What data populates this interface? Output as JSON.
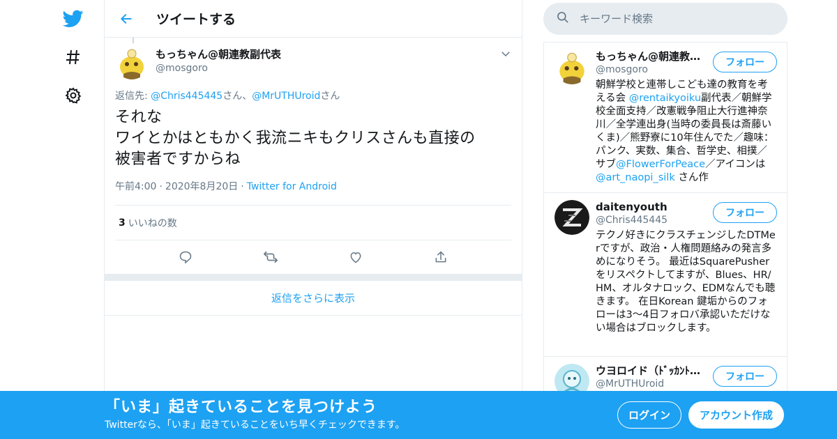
{
  "colors": {
    "brand": "#1da1f2",
    "text": "#14171a",
    "muted": "#657786",
    "border": "#e6ecf0"
  },
  "nav": {
    "icons": [
      "twitter-bird-icon",
      "hashtag-icon",
      "gear-icon"
    ]
  },
  "header": {
    "title": "ツイートする",
    "back_icon": "arrow-left-icon"
  },
  "tweet": {
    "author_name": "もっちゃん@朝連教副代表",
    "author_handle": "@mosgoro",
    "reply_prefix": "返信先: ",
    "reply_user1": "@Chris445445",
    "reply_suffix1": "さん、",
    "reply_user2": "@MrUTHUroid",
    "reply_suffix2": "さん",
    "text_line1": "それな",
    "text_line2": "ワイとかはともかく我流ニキもクリスさんも直接の",
    "text_line3": "被害者ですからね",
    "time": "午前4:00",
    "date": "2020年8月20日",
    "separator": "·",
    "source": "Twitter for Android",
    "likes_count": "3",
    "likes_label": "いいねの数",
    "actions": [
      "reply-icon",
      "retweet-icon",
      "like-icon",
      "share-icon"
    ]
  },
  "more_replies": "返信をさらに表示",
  "search": {
    "placeholder": "キーワード検索",
    "icon": "search-icon"
  },
  "users": [
    {
      "name": "もっちゃん@朝連教副代表",
      "handle": "@mosgoro",
      "follow": "フォロー",
      "bio_parts": [
        "朝鮮学校と連帯しこども達の教育を考える会 ",
        "@rentaikyoiku",
        "副代表／朝鮮学校全面支持／改憲戦争阻止大行進神奈川／全学連出身(当時の委員長は斎藤いくま)／熊野寮に10年住んでた／趣味：パンク、実数、集合、哲学史、相撲／サブ",
        "@FlowerForPeace",
        "／アイコンは ",
        "@art_naopi_silk",
        " さん作"
      ]
    },
    {
      "name": "daitenyouth",
      "handle": "@Chris445445",
      "follow": "フォロー",
      "bio": "テクノ好きにクラスチェンジしたDTMerですが、政治・人権問題絡みの発言多めになりそう。 最近はSquarePusherをリスペクトしてますが、Blues、HR/HM、オルタナロック、EDMなんでも聴きます。 在日Korean 鍵垢からのフォローは3～4日フォロバ承認いただけない場合はブロックします。"
    },
    {
      "name": "ウヨロイド（ﾄﾞｯｶﾝﾄ…",
      "handle": "@MrUTHUroid",
      "follow": "フォロー"
    }
  ],
  "banner": {
    "title": "「いま」起きていることを見つけよう",
    "subtitle": "Twitterなら、「いま」起きていることをいち早くチェックできます。",
    "login": "ログイン",
    "signup": "アカウント作成"
  }
}
